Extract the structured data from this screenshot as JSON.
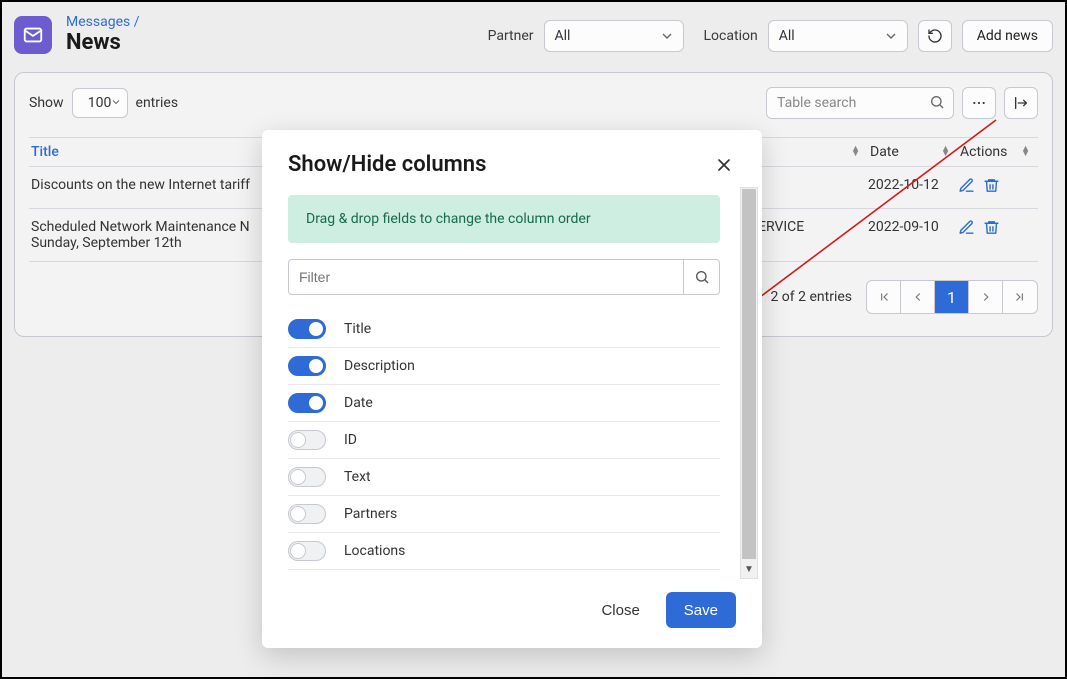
{
  "breadcrumb": {
    "parent": "Messages",
    "sep": "/",
    "title": "News"
  },
  "header": {
    "partner_label": "Partner",
    "partner_value": "All",
    "location_label": "Location",
    "location_value": "All",
    "add_news": "Add news"
  },
  "table_toolbar": {
    "show_label": "Show",
    "page_size": "100",
    "entries_label": "entries",
    "search_placeholder": "Table search"
  },
  "columns": {
    "title": "Title",
    "middle_visible": "ERVICE",
    "date": "Date",
    "actions": "Actions"
  },
  "rows": [
    {
      "title": "Discounts on the new Internet tariff",
      "middle": "",
      "date": "2022-10-12"
    },
    {
      "title": "Scheduled Network Maintenance N\nSunday, September 12th",
      "middle": "ERVICE",
      "date": "2022-09-10"
    }
  ],
  "paging": {
    "info": "2 of 2 entries",
    "page": "1"
  },
  "modal": {
    "title": "Show/Hide columns",
    "banner": "Drag & drop fields to change the column order",
    "filter_placeholder": "Filter",
    "columns": [
      {
        "label": "Title",
        "on": true
      },
      {
        "label": "Description",
        "on": true
      },
      {
        "label": "Date",
        "on": true
      },
      {
        "label": "ID",
        "on": false
      },
      {
        "label": "Text",
        "on": false
      },
      {
        "label": "Partners",
        "on": false
      },
      {
        "label": "Locations",
        "on": false
      }
    ],
    "close": "Close",
    "save": "Save"
  }
}
